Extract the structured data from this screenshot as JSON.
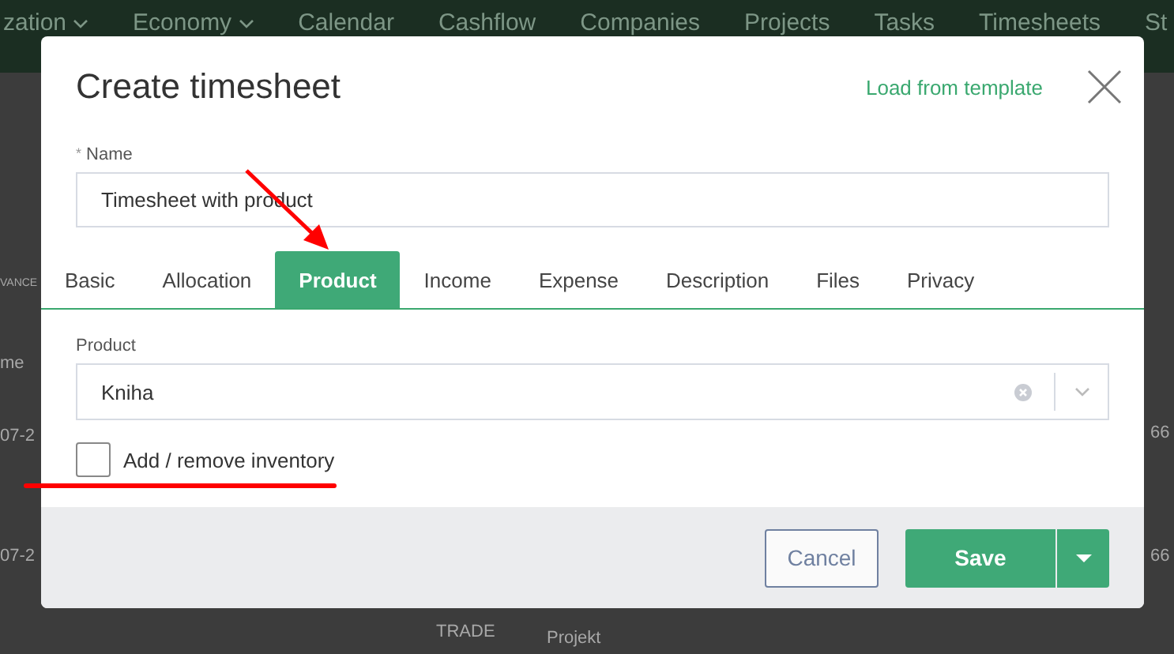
{
  "background": {
    "nav_items": [
      {
        "label": "zation",
        "dropdown": true
      },
      {
        "label": "Economy",
        "dropdown": true
      },
      {
        "label": "Calendar",
        "dropdown": false
      },
      {
        "label": "Cashflow",
        "dropdown": false
      },
      {
        "label": "Companies",
        "dropdown": false
      },
      {
        "label": "Projects",
        "dropdown": false
      },
      {
        "label": "Tasks",
        "dropdown": false
      },
      {
        "label": "Timesheets",
        "dropdown": false
      },
      {
        "label": "St",
        "dropdown": false
      }
    ],
    "fragments": [
      "VANCE",
      "me",
      "07-2",
      "66",
      "07-2",
      "66",
      "TRADE",
      "Projekt"
    ]
  },
  "dialog": {
    "title": "Create timesheet",
    "template_link": "Load from template",
    "name_field": {
      "label": "Name",
      "required_mark": "*",
      "value": "Timesheet with product"
    },
    "tabs": [
      {
        "label": "Basic",
        "selected": false
      },
      {
        "label": "Allocation",
        "selected": false
      },
      {
        "label": "Product",
        "selected": true
      },
      {
        "label": "Income",
        "selected": false
      },
      {
        "label": "Expense",
        "selected": false
      },
      {
        "label": "Description",
        "selected": false
      },
      {
        "label": "Files",
        "selected": false
      },
      {
        "label": "Privacy",
        "selected": false
      }
    ],
    "product_field": {
      "label": "Product",
      "value": "Kniha"
    },
    "inventory_checkbox": {
      "label": "Add / remove inventory",
      "checked": false
    },
    "buttons": {
      "cancel": "Cancel",
      "save": "Save"
    }
  }
}
